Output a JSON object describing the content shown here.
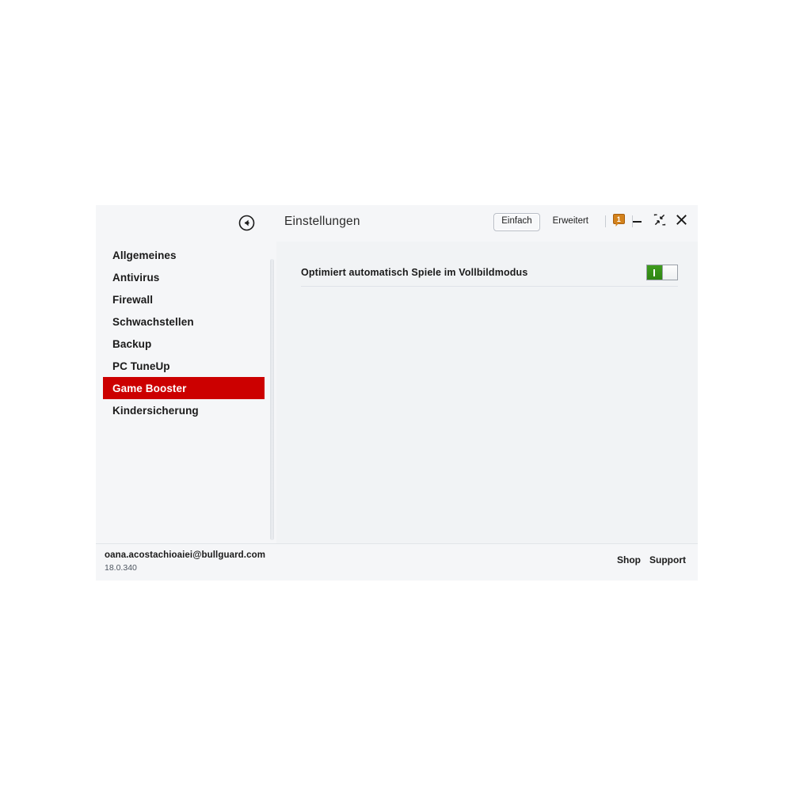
{
  "window": {
    "title": "Einstellungen",
    "back_icon": "back-circle-arrow-icon"
  },
  "titlebar": {
    "mode_simple": "Einfach",
    "mode_advanced": "Erweitert",
    "notification_count": "1",
    "minimize_icon": "minimize-icon",
    "restore_icon": "shrink-restore-icon",
    "close_icon": "close-icon"
  },
  "sidebar": {
    "items": [
      {
        "label": "Allgemeines",
        "selected": false
      },
      {
        "label": "Antivirus",
        "selected": false
      },
      {
        "label": "Firewall",
        "selected": false
      },
      {
        "label": "Schwachstellen",
        "selected": false
      },
      {
        "label": "Backup",
        "selected": false
      },
      {
        "label": "PC TuneUp",
        "selected": false
      },
      {
        "label": "Game Booster",
        "selected": true
      },
      {
        "label": "Kindersicherung",
        "selected": false
      }
    ]
  },
  "content": {
    "settings": [
      {
        "label": "Optimiert automatisch Spiele im Vollbildmodus",
        "toggle_state": "on"
      }
    ]
  },
  "footer": {
    "email": "oana.acostachioaiei@bullguard.com",
    "version": "18.0.340",
    "shop_label": "Shop",
    "support_label": "Support"
  },
  "colors": {
    "accent_red": "#cc0000",
    "toggle_green": "#3f9c1e",
    "badge_orange": "#d3821c",
    "window_bg": "#f5f6f8",
    "content_bg": "#f1f3f5"
  }
}
